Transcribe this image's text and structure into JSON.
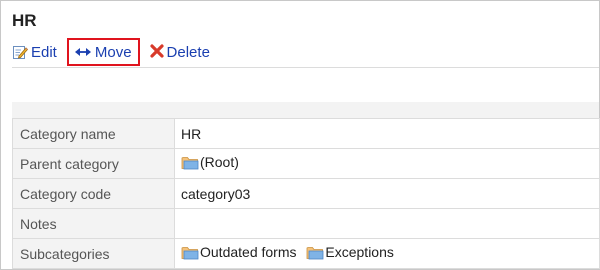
{
  "page": {
    "title": "HR"
  },
  "toolbar": {
    "edit_label": "Edit",
    "move_label": "Move",
    "delete_label": "Delete"
  },
  "details": {
    "rows": [
      {
        "label": "Category name",
        "value": "HR"
      },
      {
        "label": "Parent category",
        "value": "(Root)"
      },
      {
        "label": "Category code",
        "value": "category03"
      },
      {
        "label": "Notes",
        "value": ""
      },
      {
        "label": "Subcategories",
        "items": [
          "Outdated forms",
          "Exceptions"
        ]
      }
    ]
  },
  "colors": {
    "link": "#1a3fb0",
    "highlight_border": "#e0141e",
    "label_bg": "#f3f3f3",
    "border": "#dcdcdc"
  },
  "icons": {
    "edit": "edit-icon",
    "move": "move-arrows-icon",
    "delete": "delete-x-icon",
    "folder": "folder-icon"
  }
}
